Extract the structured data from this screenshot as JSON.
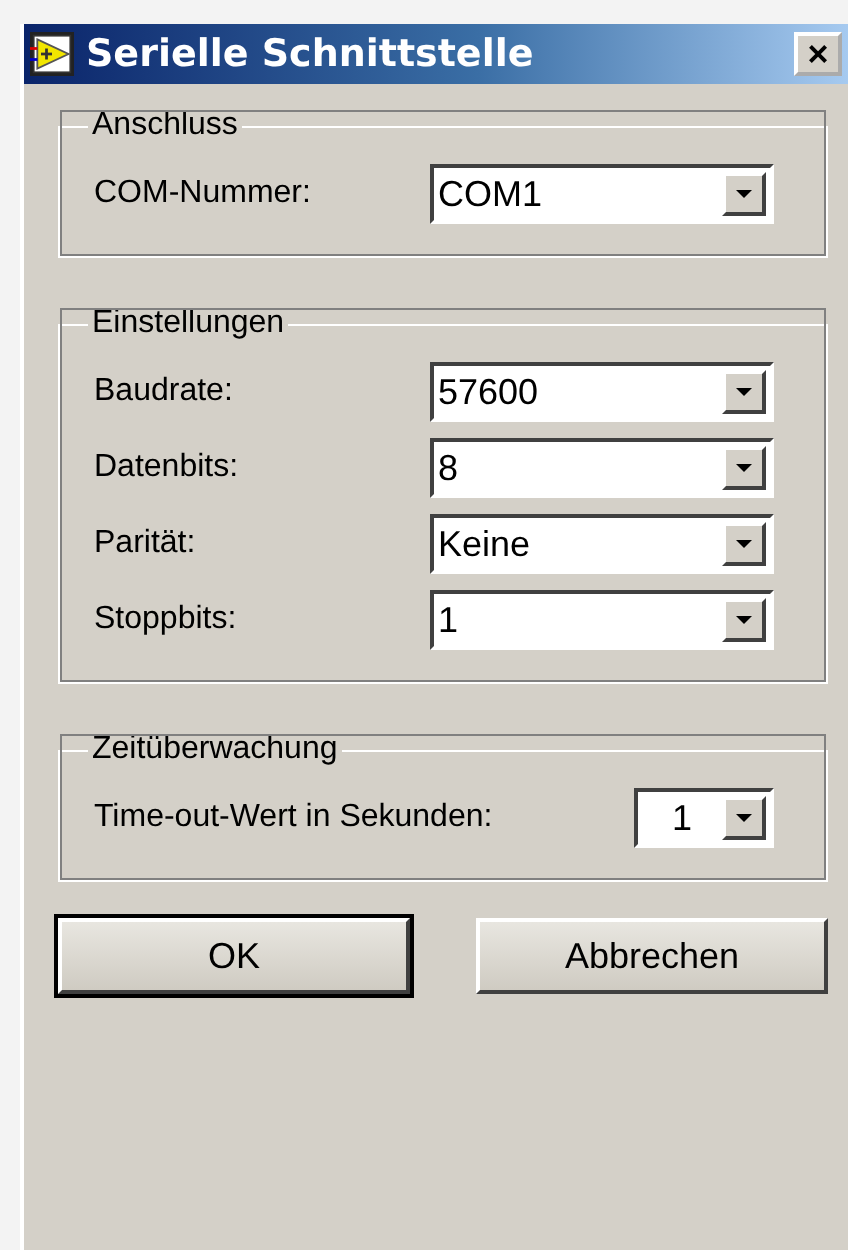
{
  "window": {
    "title": "Serielle Schnittstelle",
    "close": "×"
  },
  "groups": [
    {
      "title": "Anschluss",
      "fields": [
        {
          "label": "COM-Nummer:",
          "value": "COM1"
        }
      ]
    },
    {
      "title": "Einstellungen",
      "fields": [
        {
          "label": "Baudrate:",
          "value": "57600"
        },
        {
          "label": "Datenbits:",
          "value": "8"
        },
        {
          "label": "Parität:",
          "value": "Keine"
        },
        {
          "label": "Stoppbits:",
          "value": "1"
        }
      ]
    },
    {
      "title": "Zeitüberwachung",
      "fields": [
        {
          "label": "Time-out-Wert in Sekunden:",
          "value": "1",
          "kind": "small"
        }
      ]
    }
  ],
  "buttons": [
    {
      "label": "OK",
      "default": true
    },
    {
      "label": "Abbrechen",
      "default": false
    }
  ]
}
